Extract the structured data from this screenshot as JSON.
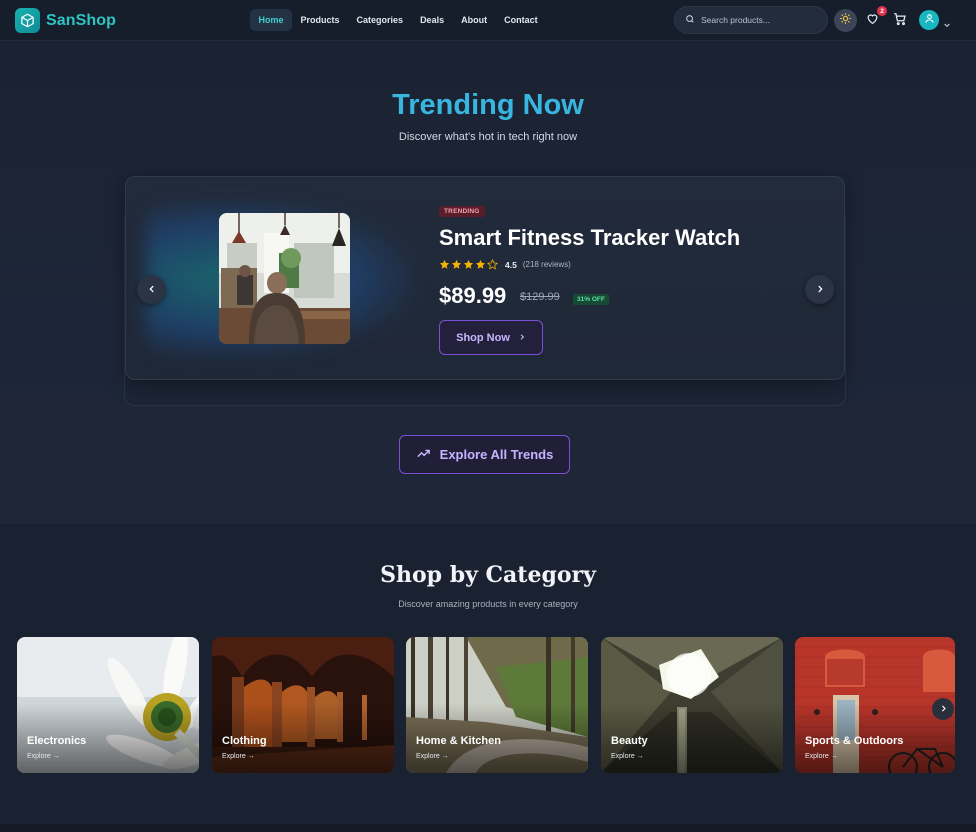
{
  "brand": {
    "name": "SanShop",
    "accent": "#2ec4c0",
    "icon": "cube-icon"
  },
  "nav": {
    "items": [
      {
        "label": "Home",
        "active": true
      },
      {
        "label": "Products",
        "active": false
      },
      {
        "label": "Categories",
        "active": false
      },
      {
        "label": "Deals",
        "active": false
      },
      {
        "label": "About",
        "active": false
      },
      {
        "label": "Contact",
        "active": false
      }
    ],
    "search_placeholder": "Search products...",
    "wishlist_count": "2",
    "icons": [
      "search-icon",
      "sun-icon",
      "heart-icon",
      "cart-icon",
      "user-icon",
      "chevron-down-icon"
    ]
  },
  "hero": {
    "title": "Trending Now",
    "subtitle": "Discover what's hot in tech right now",
    "product": {
      "tag": "TRENDING",
      "name": "Smart Fitness Tracker Watch",
      "rating": "4.5",
      "rating_stars": 4.5,
      "reviews": "(218 reviews)",
      "price": "$89.99",
      "old_price": "$129.99",
      "discount": "31% OFF",
      "cta": "Shop Now"
    },
    "explore_label": "Explore All Trends",
    "colors": {
      "title": "#38b6e0",
      "cta_border": "#7a4fd6",
      "tag_bg": "#5a1d29",
      "discount_bg": "#164a35"
    }
  },
  "categories": {
    "title": "Shop by Category",
    "subtitle": "Discover amazing products in every category",
    "items": [
      {
        "name": "Electronics",
        "explore": "Explore →"
      },
      {
        "name": "Clothing",
        "explore": "Explore →"
      },
      {
        "name": "Home & Kitchen",
        "explore": "Explore →"
      },
      {
        "name": "Beauty",
        "explore": "Explore →"
      },
      {
        "name": "Sports & Outdoors",
        "explore": "Explore →"
      }
    ]
  }
}
